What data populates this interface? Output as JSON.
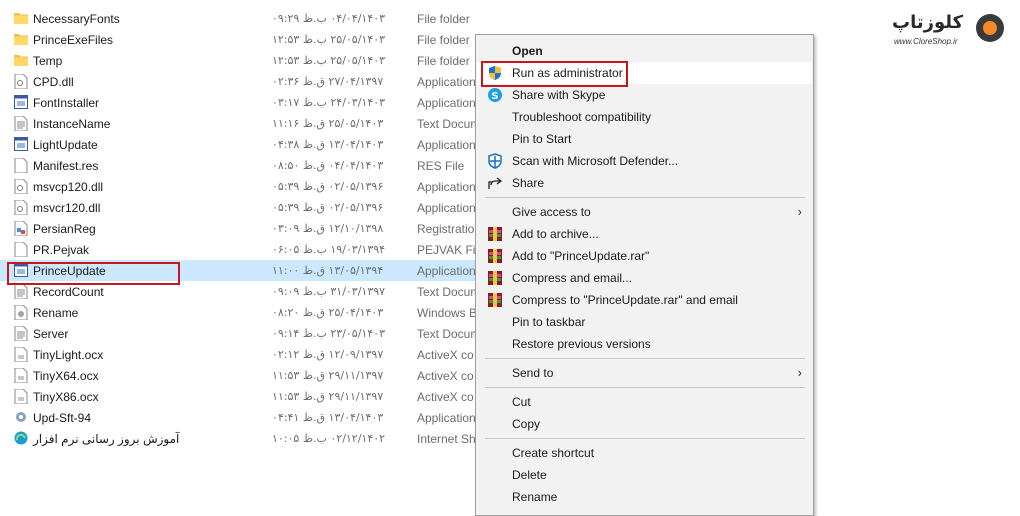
{
  "files": [
    {
      "name": "NecessaryFonts",
      "date": "۰۴/۰۴/۱۴۰۳ ب.ظ ۰۹:۲۹",
      "type": "File folder",
      "icon": "folder-icon"
    },
    {
      "name": "PrinceExeFiles",
      "date": "۲۵/۰۵/۱۴۰۳ ب.ظ ۱۲:۵۳",
      "type": "File folder",
      "icon": "folder-icon"
    },
    {
      "name": "Temp",
      "date": "۲۵/۰۵/۱۴۰۳ ب.ظ ۱۲:۵۳",
      "type": "File folder",
      "icon": "folder-icon"
    },
    {
      "name": "CPD.dll",
      "date": "۲۷/۰۴/۱۳۹۷ ق.ظ ۰۲:۳۶",
      "type": "Application",
      "icon": "dll-icon"
    },
    {
      "name": "FontInstaller",
      "date": "۲۴/۰۳/۱۴۰۳ ب.ظ ۰۳:۱۷",
      "type": "Application",
      "icon": "app-icon"
    },
    {
      "name": "InstanceName",
      "date": "۲۵/۰۵/۱۴۰۳ ق.ظ ۱۱:۱۶",
      "type": "Text Docum",
      "icon": "text-file-icon"
    },
    {
      "name": "LightUpdate",
      "date": "۱۳/۰۴/۱۴۰۳ ق.ظ ۰۴:۳۸",
      "type": "Application",
      "icon": "app-icon"
    },
    {
      "name": "Manifest.res",
      "date": "۰۴/۰۴/۱۴۰۳ ق.ظ ۰۸:۵۰",
      "type": "RES File",
      "icon": "file-icon"
    },
    {
      "name": "msvcp120.dll",
      "date": "۰۲/۰۵/۱۳۹۶ ق.ظ ۰۵:۳۹",
      "type": "Application",
      "icon": "dll-icon"
    },
    {
      "name": "msvcr120.dll",
      "date": "۰۲/۰۵/۱۳۹۶ ق.ظ ۰۵:۳۹",
      "type": "Application",
      "icon": "dll-icon"
    },
    {
      "name": "PersianReg",
      "date": "۱۲/۱۰/۱۳۹۸ ق.ظ ۰۳:۰۹",
      "type": "Registration",
      "icon": "registry-icon"
    },
    {
      "name": "PR.Pejvak",
      "date": "۱۹/۰۳/۱۳۹۴ ب.ظ ۰۶:۰۵",
      "type": "PEJVAK File",
      "icon": "file-icon"
    },
    {
      "name": "PrinceUpdate",
      "date": "۱۳/۰۵/۱۳۹۴ ق.ظ ۱۱:۰۰",
      "type": "Application",
      "icon": "app-icon"
    },
    {
      "name": "RecordCount",
      "date": "۳۱/۰۳/۱۳۹۷ ب.ظ ۰۹:۰۹",
      "type": "Text Docum",
      "icon": "text-file-icon"
    },
    {
      "name": "Rename",
      "date": "۲۵/۰۴/۱۴۰۳ ق.ظ ۰۸:۲۰",
      "type": "Windows B",
      "icon": "batch-file-icon"
    },
    {
      "name": "Server",
      "date": "۲۳/۰۵/۱۴۰۳ ب.ظ ۰۹:۱۴",
      "type": "Text Docum",
      "icon": "text-file-icon"
    },
    {
      "name": "TinyLight.ocx",
      "date": "۱۲/۰۹/۱۳۹۷ ق.ظ ۰۲:۱۲",
      "type": "ActiveX co",
      "icon": "ocx-icon"
    },
    {
      "name": "TinyX64.ocx",
      "date": "۲۹/۱۱/۱۳۹۷ ق.ظ ۱۱:۵۳",
      "type": "ActiveX co",
      "icon": "ocx-icon"
    },
    {
      "name": "TinyX86.ocx",
      "date": "۲۹/۱۱/۱۳۹۷ ق.ظ ۱۱:۵۳",
      "type": "ActiveX co",
      "icon": "ocx-icon"
    },
    {
      "name": "Upd-Sft-94",
      "date": "۱۳/۰۴/۱۴۰۳ ق.ظ ۰۴:۴۱",
      "type": "Application",
      "icon": "gear-app-icon"
    },
    {
      "name": "آموزش بروز رسانی نرم افزار",
      "date": "۰۲/۱۲/۱۴۰۲ ب.ظ ۱۰:۰۵",
      "type": "Internet Sh",
      "icon": "edge-shortcut-icon"
    }
  ],
  "selected_file": "PrinceUpdate",
  "menu": [
    {
      "label": "Open",
      "bold": true,
      "icon": ""
    },
    {
      "label": "Run as administrator",
      "icon": "shield-icon",
      "hover": true
    },
    {
      "label": "Share with Skype",
      "icon": "skype-icon"
    },
    {
      "label": "Troubleshoot compatibility",
      "icon": ""
    },
    {
      "label": "Pin to Start",
      "icon": ""
    },
    {
      "label": "Scan with Microsoft Defender...",
      "icon": "defender-icon"
    },
    {
      "label": "Share",
      "icon": "share-icon"
    },
    {
      "sep": true
    },
    {
      "label": "Give access to",
      "icon": "",
      "submenu": true
    },
    {
      "label": "Add to archive...",
      "icon": "winrar-icon"
    },
    {
      "label": "Add to \"PrinceUpdate.rar\"",
      "icon": "winrar-icon"
    },
    {
      "label": "Compress and email...",
      "icon": "winrar-icon"
    },
    {
      "label": "Compress to \"PrinceUpdate.rar\" and email",
      "icon": "winrar-icon"
    },
    {
      "label": "Pin to taskbar",
      "icon": ""
    },
    {
      "label": "Restore previous versions",
      "icon": ""
    },
    {
      "sep": true
    },
    {
      "label": "Send to",
      "icon": "",
      "submenu": true
    },
    {
      "sep": true
    },
    {
      "label": "Cut",
      "icon": ""
    },
    {
      "label": "Copy",
      "icon": ""
    },
    {
      "sep": true
    },
    {
      "label": "Create shortcut",
      "icon": ""
    },
    {
      "label": "Delete",
      "icon": ""
    },
    {
      "label": "Rename",
      "icon": ""
    }
  ],
  "submenu_arrow": "›",
  "logo": {
    "text": "کلوزتاپ",
    "subtext": "www.CloreShop.ir"
  },
  "colors": {
    "highlight_box": "#c8161d",
    "selection": "#cce8ff",
    "menu_bg": "#f2f2f2"
  }
}
